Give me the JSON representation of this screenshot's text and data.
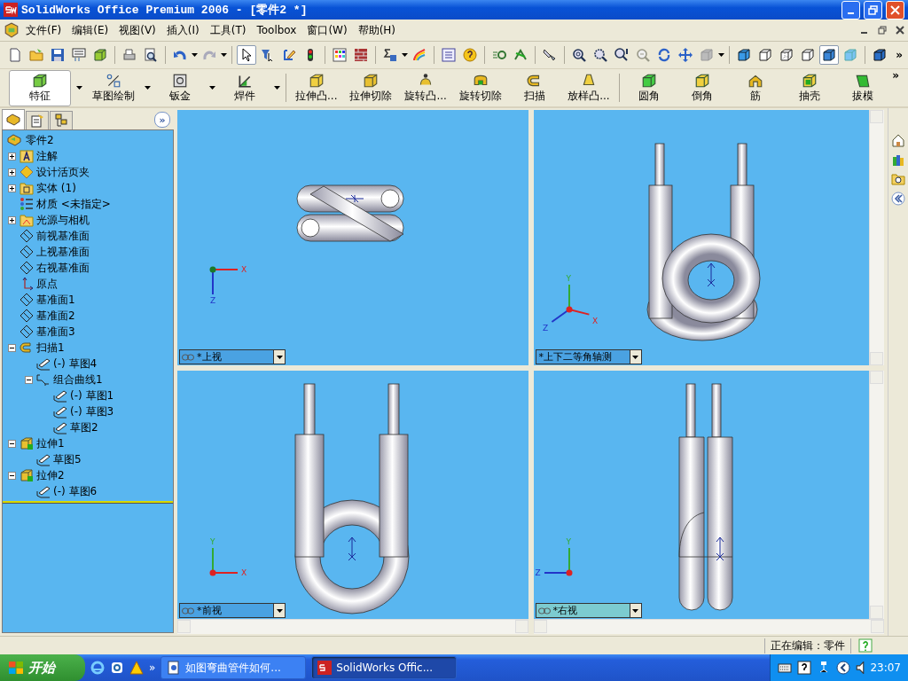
{
  "window": {
    "title": "SolidWorks Office Premium 2006 - [零件2 *]"
  },
  "menu": [
    "文件(F)",
    "编辑(E)",
    "视图(V)",
    "插入(I)",
    "工具(T)",
    "Toolbox",
    "窗口(W)",
    "帮助(H)"
  ],
  "standard_toolbar": {
    "buttons": [
      {
        "selected": false
      },
      {
        "selected": false
      },
      {
        "selected": false
      },
      {
        "selected": false
      },
      {
        "selected": false
      },
      {
        "selected": false
      },
      {
        "selected": false
      },
      {
        "selected": false
      },
      {
        "selected": false
      },
      {
        "selected": true
      },
      {
        "selected": false
      },
      {
        "selected": false
      },
      {
        "selected": false
      },
      {
        "selected": false
      },
      {
        "selected": false
      },
      {
        "selected": false
      },
      {
        "selected": false
      },
      {
        "selected": false
      },
      {
        "selected": false
      },
      {
        "selected": false
      },
      {
        "selected": false
      },
      {
        "selected": false
      },
      {
        "selected": false
      },
      {
        "selected": false
      },
      {
        "selected": false
      },
      {
        "selected": false
      },
      {
        "selected": false
      },
      {
        "selected": false
      },
      {
        "selected": false
      },
      {
        "selected": false
      },
      {
        "selected": false
      },
      {
        "selected": false
      },
      {
        "selected": false
      },
      {
        "selected": true
      },
      {
        "selected": false
      },
      {
        "selected": false
      }
    ],
    "overflow": "»"
  },
  "command_manager": {
    "items": [
      {
        "kind": "group",
        "label": "特征",
        "selected": true
      },
      {
        "kind": "group",
        "label": "草图绘制",
        "selected": false
      },
      {
        "kind": "group",
        "label": "钣金",
        "selected": false
      },
      {
        "kind": "group",
        "label": "焊件",
        "selected": false
      },
      {
        "kind": "command",
        "label": "拉伸凸..."
      },
      {
        "kind": "command",
        "label": "拉伸切除"
      },
      {
        "kind": "command",
        "label": "旋转凸..."
      },
      {
        "kind": "command",
        "label": "旋转切除"
      },
      {
        "kind": "command",
        "label": "扫描"
      },
      {
        "kind": "command",
        "label": "放样凸..."
      },
      {
        "kind": "command",
        "label": "圆角"
      },
      {
        "kind": "command",
        "label": "倒角"
      },
      {
        "kind": "command",
        "label": "筋"
      },
      {
        "kind": "command",
        "label": "抽壳"
      },
      {
        "kind": "command",
        "label": "拔模"
      }
    ],
    "overflow": "»"
  },
  "panel_tabs": [
    {
      "selected": true
    },
    {
      "selected": false
    },
    {
      "selected": false
    }
  ],
  "panel_expand": "»",
  "feature_tree": {
    "label": "零件2",
    "kind": "part",
    "children": [
      {
        "label": "注解",
        "kind": "annotation",
        "expanded": false
      },
      {
        "label": "设计活页夹",
        "kind": "binder",
        "expanded": false
      },
      {
        "label": "实体 (1)",
        "kind": "solid",
        "expanded": false
      },
      {
        "label": "材质 <未指定>",
        "kind": "material"
      },
      {
        "label": "光源与相机",
        "kind": "lights",
        "expanded": false
      },
      {
        "label": "前视基准面",
        "kind": "plane"
      },
      {
        "label": "上视基准面",
        "kind": "plane"
      },
      {
        "label": "右视基准面",
        "kind": "plane"
      },
      {
        "label": "原点",
        "kind": "origin"
      },
      {
        "label": "基准面1",
        "kind": "plane"
      },
      {
        "label": "基准面2",
        "kind": "plane"
      },
      {
        "label": "基准面3",
        "kind": "plane"
      },
      {
        "label": "扫描1",
        "kind": "sweep",
        "expanded": true,
        "children": [
          {
            "label": "(-) 草图4",
            "kind": "sketch"
          },
          {
            "label": "组合曲线1",
            "kind": "curve",
            "expanded": true,
            "children": [
              {
                "label": "(-) 草图1",
                "kind": "sketch"
              },
              {
                "label": "(-) 草图3",
                "kind": "sketch"
              },
              {
                "label": "草图2",
                "kind": "sketch"
              }
            ]
          }
        ]
      },
      {
        "label": "拉伸1",
        "kind": "extrude",
        "expanded": true,
        "children": [
          {
            "label": "草图5",
            "kind": "sketch"
          }
        ]
      },
      {
        "label": "拉伸2",
        "kind": "extrude",
        "expanded": true,
        "children": [
          {
            "label": "(-) 草图6",
            "kind": "sketch"
          }
        ]
      }
    ]
  },
  "views": [
    {
      "kind": "top",
      "label": "*上视",
      "linked": true,
      "active": false,
      "axes": [
        "X",
        "Z"
      ]
    },
    {
      "kind": "iso",
      "label": "*上下二等角轴测",
      "linked": false,
      "active": false,
      "axes": [
        "Y",
        "Z",
        "X"
      ]
    },
    {
      "kind": "front",
      "label": "*前视",
      "linked": true,
      "active": false,
      "axes": [
        "Y",
        "X"
      ]
    },
    {
      "kind": "right",
      "label": "*右视",
      "linked": true,
      "active": true,
      "axes": [
        "Y",
        "Z"
      ]
    }
  ],
  "status_bar": {
    "text": "正在编辑：零件"
  },
  "taskbar": {
    "start": "开始",
    "quick_launch_more": "»",
    "tasks": [
      {
        "label": "如图弯曲管件如何...",
        "selected": false
      },
      {
        "label": "SolidWorks Offic...",
        "selected": true
      }
    ],
    "clock": "23:07"
  }
}
